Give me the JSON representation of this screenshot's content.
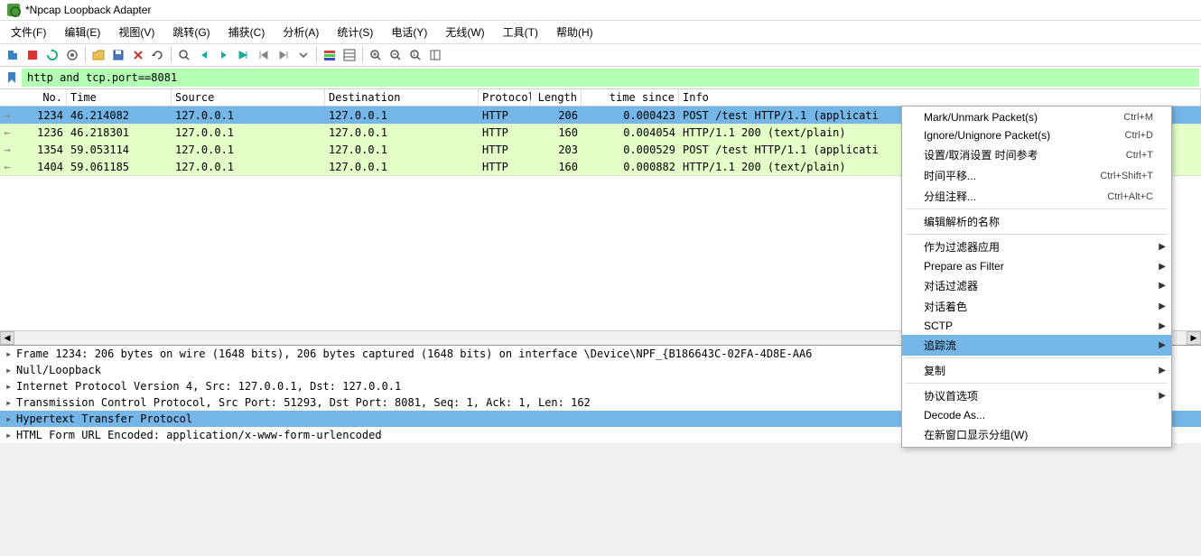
{
  "window": {
    "title": "*Npcap Loopback Adapter"
  },
  "menu": {
    "file": "文件(F)",
    "edit": "编辑(E)",
    "view": "视图(V)",
    "goto": "跳转(G)",
    "capture": "捕获(C)",
    "analyze": "分析(A)",
    "stats": "统计(S)",
    "phone": "电话(Y)",
    "wireless": "无线(W)",
    "tools": "工具(T)",
    "help": "帮助(H)"
  },
  "filter": {
    "value": "http and tcp.port==8081"
  },
  "columns": {
    "no": "No.",
    "time": "Time",
    "source": "Source",
    "destination": "Destination",
    "protocol": "Protocol",
    "length": "Length",
    "time_since": "time since",
    "info": "Info"
  },
  "packets": [
    {
      "no": "1234",
      "time": "46.214082",
      "src": "127.0.0.1",
      "dst": "127.0.0.1",
      "proto": "HTTP",
      "len": "206",
      "since": "0.000423",
      "info": "POST /test HTTP/1.1  (applicati",
      "selected": true,
      "arrow": "→"
    },
    {
      "no": "1236",
      "time": "46.218301",
      "src": "127.0.0.1",
      "dst": "127.0.0.1",
      "proto": "HTTP",
      "len": "160",
      "since": "0.004054",
      "info": "HTTP/1.1 200   (text/plain)",
      "selected": false,
      "arrow": "←"
    },
    {
      "no": "1354",
      "time": "59.053114",
      "src": "127.0.0.1",
      "dst": "127.0.0.1",
      "proto": "HTTP",
      "len": "203",
      "since": "0.000529",
      "info": "POST /test HTTP/1.1  (applicati",
      "selected": false,
      "arrow": "→"
    },
    {
      "no": "1404",
      "time": "59.061185",
      "src": "127.0.0.1",
      "dst": "127.0.0.1",
      "proto": "HTTP",
      "len": "160",
      "since": "0.000882",
      "info": "HTTP/1.1 200   (text/plain)",
      "selected": false,
      "arrow": "←"
    }
  ],
  "details": {
    "line0": "Frame 1234: 206 bytes on wire (1648 bits), 206 bytes captured (1648 bits) on interface \\Device\\NPF_{B186643C-02FA-4D8E-AA6",
    "line1": "Null/Loopback",
    "line2": "Internet Protocol Version 4, Src: 127.0.0.1, Dst: 127.0.0.1",
    "line3": "Transmission Control Protocol, Src Port: 51293, Dst Port: 8081, Seq: 1, Ack: 1, Len: 162",
    "line4": "Hypertext Transfer Protocol",
    "line5": "HTML Form URL Encoded: application/x-www-form-urlencoded"
  },
  "context": {
    "mark": "Mark/Unmark Packet(s)",
    "mark_sc": "Ctrl+M",
    "ignore": "Ignore/Unignore Packet(s)",
    "ignore_sc": "Ctrl+D",
    "timeref": "设置/取消设置 时间参考",
    "timeref_sc": "Ctrl+T",
    "timeshift": "时间平移...",
    "timeshift_sc": "Ctrl+Shift+T",
    "pktcomment": "分组注释...",
    "pktcomment_sc": "Ctrl+Alt+C",
    "editname": "编辑解析的名称",
    "applyfilter": "作为过滤器应用",
    "prepfilter": "Prepare as Filter",
    "convfilter": "对话过滤器",
    "convcolor": "对话着色",
    "sctp": "SCTP",
    "followstream": "追踪流",
    "copy": "复制",
    "protopref": "协议首选项",
    "decodeas": "Decode As...",
    "newwindow": "在新窗口显示分组(W)"
  }
}
